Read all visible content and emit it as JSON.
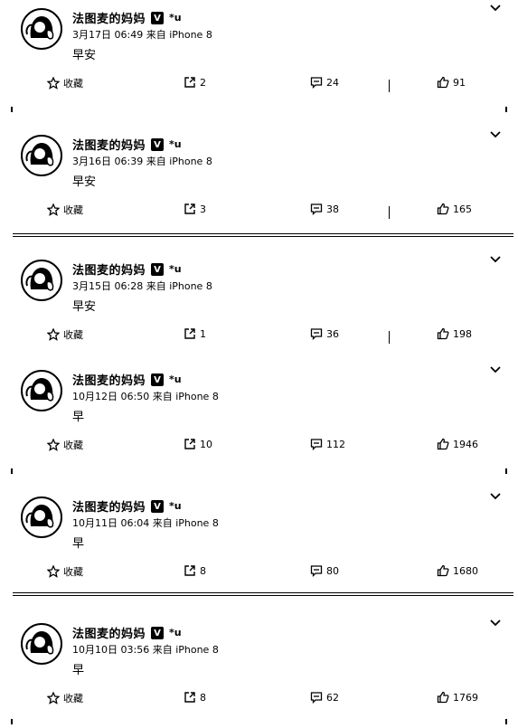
{
  "user": {
    "name": "法图麦的妈妈",
    "verified": "V",
    "level": "*u"
  },
  "actions": {
    "fav_label": "收藏"
  },
  "posts": [
    {
      "date": "3月17日 06:49",
      "source": "来自 iPhone 8",
      "text": "早安",
      "shares": "2",
      "comments": "24",
      "likes": "91"
    },
    {
      "date": "3月16日 06:39",
      "source": "来自 iPhone 8",
      "text": "早安",
      "shares": "3",
      "comments": "38",
      "likes": "165"
    },
    {
      "date": "3月15日 06:28",
      "source": "来自 iPhone 8",
      "text": "早安",
      "shares": "1",
      "comments": "36",
      "likes": "198"
    },
    {
      "date": "10月12日 06:50",
      "source": "来自 iPhone 8",
      "text": "早",
      "shares": "10",
      "comments": "112",
      "likes": "1946"
    },
    {
      "date": "10月11日 06:04",
      "source": "来自 iPhone 8",
      "text": "早",
      "shares": "8",
      "comments": "80",
      "likes": "1680"
    },
    {
      "date": "10月10日 03:56",
      "source": "来自 iPhone 8",
      "text": "早",
      "shares": "8",
      "comments": "62",
      "likes": "1769"
    }
  ]
}
